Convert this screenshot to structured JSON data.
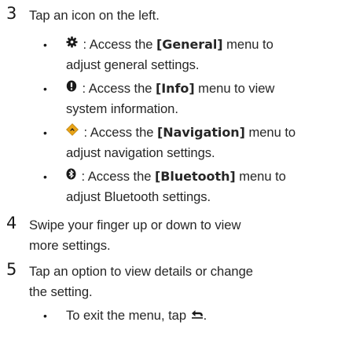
{
  "steps": [
    {
      "number": "3",
      "text": "Tap an icon on the left.",
      "bullets": [
        {
          "icon": "gear-icon",
          "pre": " : Access the ",
          "bold": "[General]",
          "post1": " menu to",
          "post2": "adjust general settings."
        },
        {
          "icon": "info-icon",
          "pre": " : Access the ",
          "bold": "[Info]",
          "post1": " menu to view",
          "post2": "system information."
        },
        {
          "icon": "navigation-icon",
          "pre": " : Access the ",
          "bold": "[Navigation]",
          "post1": " menu to",
          "post2": "adjust navigation settings."
        },
        {
          "icon": "bluetooth-icon",
          "pre": " : Access the ",
          "bold": "[Bluetooth]",
          "post1": " menu to",
          "post2": "adjust Bluetooth settings."
        }
      ]
    },
    {
      "number": "4",
      "line1": "Swipe your finger up or down to view",
      "line2": "more settings."
    },
    {
      "number": "5",
      "line1": "Tap an option to view details or change",
      "line2": "the setting.",
      "bullet": {
        "text": "To exit the menu, tap ",
        "icon": "back-icon",
        "tail": "."
      }
    }
  ],
  "bullet_char": "•",
  "colors": {
    "text": "#262626",
    "nav_icon_orange": "#e8a317",
    "nav_icon_dark": "#1a1a1a"
  }
}
